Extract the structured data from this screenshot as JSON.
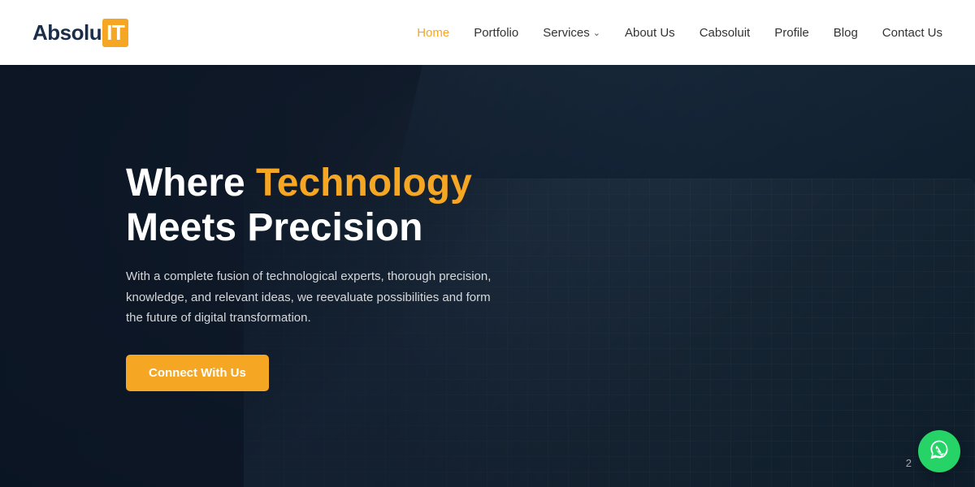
{
  "logo": {
    "text_before": "Absolu",
    "text_it": "IT"
  },
  "nav": {
    "items": [
      {
        "label": "Home",
        "active": true,
        "id": "home"
      },
      {
        "label": "Portfolio",
        "active": false,
        "id": "portfolio"
      },
      {
        "label": "Services",
        "active": false,
        "id": "services",
        "has_dropdown": true
      },
      {
        "label": "About Us",
        "active": false,
        "id": "about"
      },
      {
        "label": "Cabsoluit",
        "active": false,
        "id": "cabsoluit"
      },
      {
        "label": "Profile",
        "active": false,
        "id": "profile"
      },
      {
        "label": "Blog",
        "active": false,
        "id": "blog"
      },
      {
        "label": "Contact Us",
        "active": false,
        "id": "contact"
      }
    ]
  },
  "hero": {
    "title_part1": "Where ",
    "title_highlight": "Technology",
    "title_part2": "Meets Precision",
    "subtitle": "With a complete fusion of technological experts, thorough precision, knowledge, and relevant ideas, we reevaluate possibilities and form the future of digital transformation.",
    "cta_label": "Connect With Us"
  },
  "fab": {
    "whatsapp_icon": "💬",
    "aria_label": "WhatsApp Chat"
  },
  "page_number": "2"
}
